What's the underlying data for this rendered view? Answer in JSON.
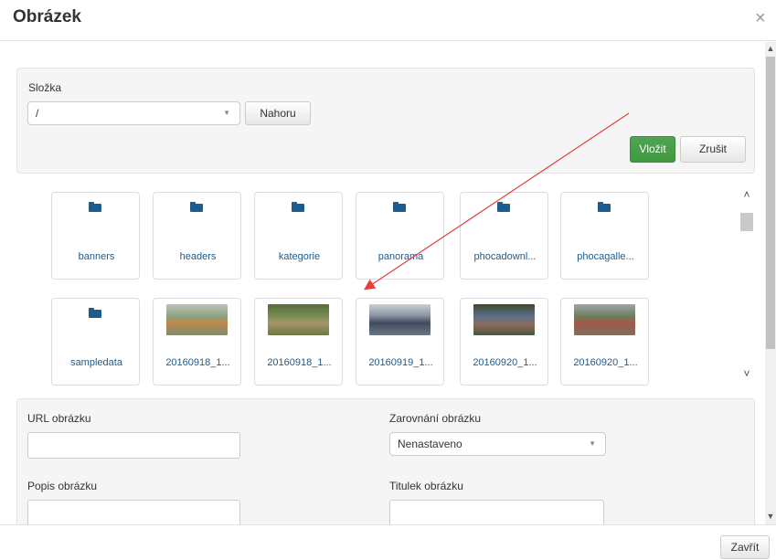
{
  "dialog": {
    "title": "Obrázek",
    "close_label": "×"
  },
  "folder_panel": {
    "folder_label": "Složka",
    "folder_value": "/",
    "up_button": "Nahoru",
    "insert_button": "Vložit",
    "cancel_button": "Zrušit"
  },
  "gallery": {
    "folders": [
      "banners",
      "headers",
      "kategorie",
      "panorama",
      "phocadownl...",
      "phocagalle...",
      "sampledata"
    ],
    "images": [
      "20160918_1...",
      "20160918_1...",
      "20160919_1...",
      "20160920_1...",
      "20160920_1..."
    ]
  },
  "fields": {
    "url_label": "URL obrázku",
    "url_value": "",
    "align_label": "Zarovnání obrázku",
    "align_value": "Nenastaveno",
    "desc_label": "Popis obrázku",
    "desc_value": "",
    "title_label": "Titulek obrázku",
    "title_value": ""
  },
  "footer": {
    "close_button": "Zavřít"
  },
  "colors": {
    "accent_green": "#4cae4c",
    "folder_icon": "#1d5c8c",
    "link_text": "#1f5a8c",
    "annotation_arrow": "#e8403a"
  }
}
